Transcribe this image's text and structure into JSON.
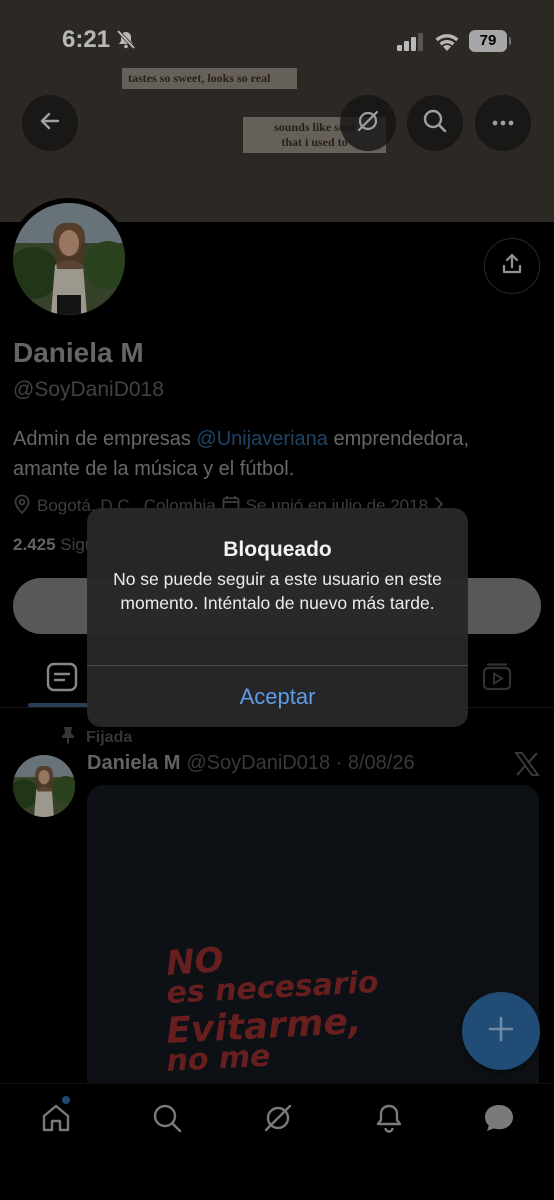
{
  "status_bar": {
    "time": "6:21",
    "battery": "79"
  },
  "banner": {
    "note_line_1": "tastes so sweet, looks so real",
    "note_line_2": "sounds like som",
    "note_line_3": "that i used to"
  },
  "profile": {
    "name": "Daniela M",
    "handle": "@SoyDaniD018",
    "bio_part_1": "Admin de empresas ",
    "bio_mention": "@Unijaveriana",
    "bio_part_2": " emprendedora, amante de la música y el fútbol.",
    "location": "Bogotá, D.C., Colombia",
    "joined": "Se unió en julio de 2018",
    "following_count": "2.425",
    "following_label": "Siguiendo"
  },
  "pinned_post": {
    "pinned_label": "Fijada",
    "author_name": "Daniela M",
    "author_handle_date": "@SoyDaniD018 · 8/08/26",
    "image_text_1": "NO",
    "image_text_2": "es necesario",
    "image_text_3": "Evitarme,",
    "image_text_4": "no me"
  },
  "alert": {
    "title": "Bloqueado",
    "message": "No se puede seguir a este usuario en este momento. Inténtalo de nuevo más tarde.",
    "button": "Aceptar"
  },
  "colors": {
    "accent": "#5f9bea",
    "fab": "#2d6aa3",
    "background": "#000000",
    "banner": "#3e3833"
  }
}
